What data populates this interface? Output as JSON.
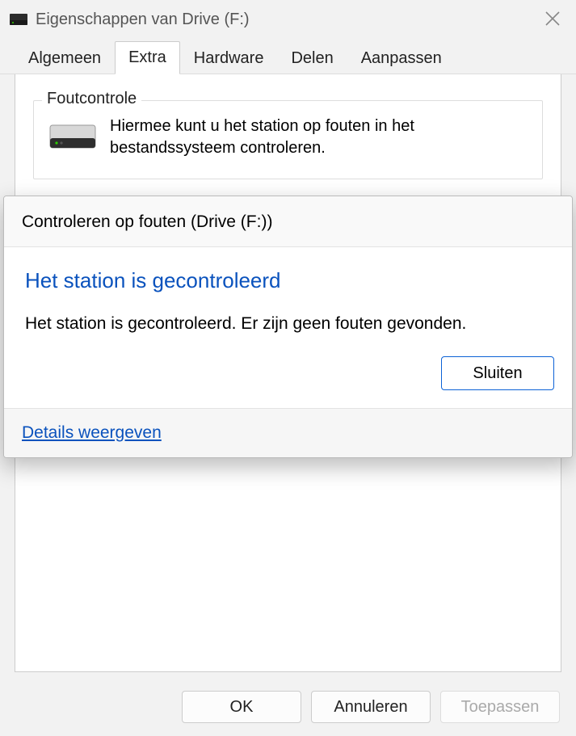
{
  "window": {
    "title": "Eigenschappen van Drive (F:)"
  },
  "tabs": {
    "items": [
      {
        "label": "Algemeen"
      },
      {
        "label": "Extra"
      },
      {
        "label": "Hardware"
      },
      {
        "label": "Delen"
      },
      {
        "label": "Aanpassen"
      }
    ],
    "active_index": 1
  },
  "group": {
    "title": "Foutcontrole",
    "description": "Hiermee kunt u het station op fouten in het bestandssysteem controleren."
  },
  "popup": {
    "title": "Controleren op fouten (Drive (F:))",
    "heading": "Het station is gecontroleerd",
    "message": "Het station is gecontroleerd. Er zijn geen fouten gevonden.",
    "close_label": "Sluiten",
    "details_label": "Details weergeven"
  },
  "buttons": {
    "ok": "OK",
    "cancel": "Annuleren",
    "apply": "Toepassen"
  }
}
